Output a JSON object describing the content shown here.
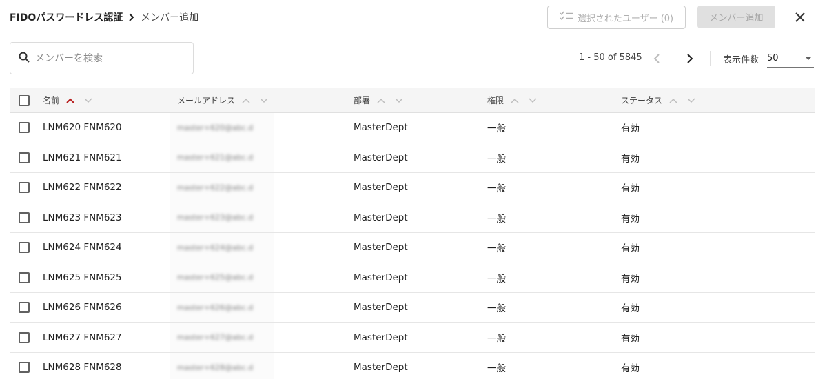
{
  "breadcrumb": {
    "root": "FIDOパスワードレス認証",
    "current": "メンバー追加"
  },
  "toolbar": {
    "selected_users_label": "選択されたユーザー (0)",
    "add_member_label": "メンバー追加"
  },
  "icons": {
    "breadcrumb_separator": "chevron-right-icon",
    "selected_users": "checklist-icon",
    "close": "close-icon",
    "search": "search-icon",
    "prev": "chevron-left-icon",
    "next": "chevron-right-icon",
    "sort_asc": "sort-up-icon",
    "sort_desc": "sort-down-icon"
  },
  "search": {
    "placeholder": "メンバーを検索",
    "value": ""
  },
  "pagination": {
    "range": "1 - 50 of 5845",
    "per_page_label": "表示件数",
    "per_page_value": "50"
  },
  "colors": {
    "active_sort": "#b71c1c",
    "inactive_sort": "#bdbdbd",
    "header_bg": "#f5f5f5"
  },
  "table": {
    "columns": [
      {
        "label": "名前",
        "sort_active": "asc"
      },
      {
        "label": "メールアドレス",
        "sort_active": ""
      },
      {
        "label": "部署",
        "sort_active": ""
      },
      {
        "label": "権限",
        "sort_active": ""
      },
      {
        "label": "ステータス",
        "sort_active": ""
      }
    ],
    "rows": [
      {
        "name": "LNM620 FNM620",
        "email": "master+620@abc.d",
        "dept": "MasterDept",
        "role": "一般",
        "status": "有効"
      },
      {
        "name": "LNM621 FNM621",
        "email": "master+621@abc.d",
        "dept": "MasterDept",
        "role": "一般",
        "status": "有効"
      },
      {
        "name": "LNM622 FNM622",
        "email": "master+622@abc.d",
        "dept": "MasterDept",
        "role": "一般",
        "status": "有効"
      },
      {
        "name": "LNM623 FNM623",
        "email": "master+623@abc.d",
        "dept": "MasterDept",
        "role": "一般",
        "status": "有効"
      },
      {
        "name": "LNM624 FNM624",
        "email": "master+624@abc.d",
        "dept": "MasterDept",
        "role": "一般",
        "status": "有効"
      },
      {
        "name": "LNM625 FNM625",
        "email": "master+625@abc.d",
        "dept": "MasterDept",
        "role": "一般",
        "status": "有効"
      },
      {
        "name": "LNM626 FNM626",
        "email": "master+626@abc.d",
        "dept": "MasterDept",
        "role": "一般",
        "status": "有効"
      },
      {
        "name": "LNM627 FNM627",
        "email": "master+627@abc.d",
        "dept": "MasterDept",
        "role": "一般",
        "status": "有効"
      },
      {
        "name": "LNM628 FNM628",
        "email": "master+628@abc.d",
        "dept": "MasterDept",
        "role": "一般",
        "status": "有効"
      }
    ]
  }
}
